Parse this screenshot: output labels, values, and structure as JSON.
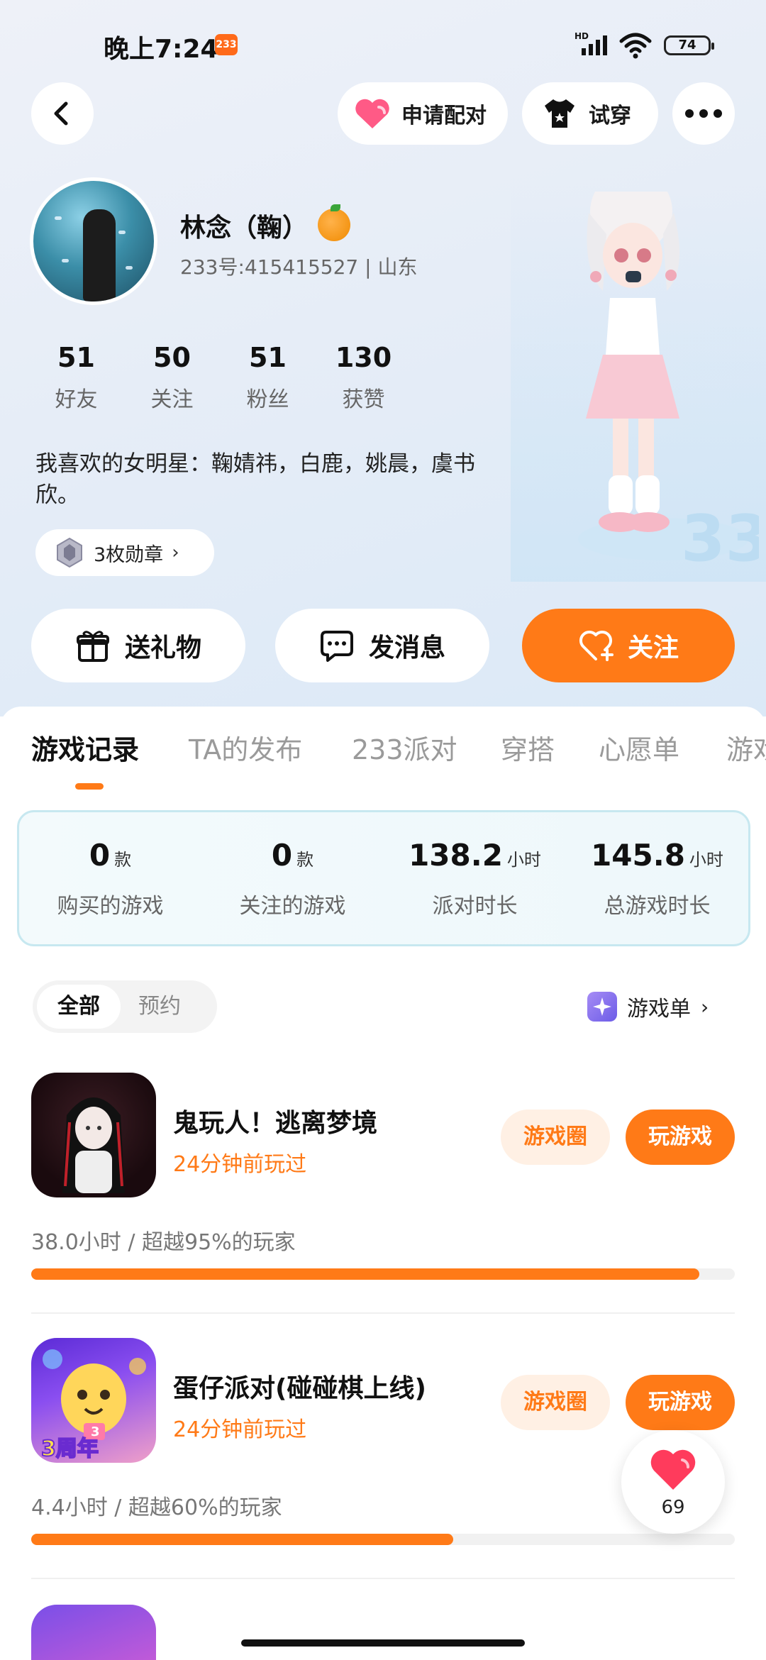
{
  "status": {
    "time": "晚上7:24",
    "badge": "233",
    "network": "HD",
    "battery": "74"
  },
  "header": {
    "pair_label": "申请配对",
    "try_label": "试穿"
  },
  "profile": {
    "name": "林念（鞠）",
    "id_line": "233号:415415527 | 山东",
    "stats": [
      {
        "value": "51",
        "label": "好友"
      },
      {
        "value": "50",
        "label": "关注"
      },
      {
        "value": "51",
        "label": "粉丝"
      },
      {
        "value": "130",
        "label": "获赞"
      }
    ],
    "bio": "我喜欢的女明星：鞠婧祎，白鹿，姚晨，虞书欣。",
    "badges": "3枚勋章"
  },
  "actions": {
    "gift": "送礼物",
    "message": "发消息",
    "follow": "关注"
  },
  "tabs": [
    "游戏记录",
    "TA的发布",
    "233派对",
    "穿搭",
    "心愿单",
    "游戏"
  ],
  "summary": [
    {
      "value": "0",
      "unit": "款",
      "label": "购买的游戏"
    },
    {
      "value": "0",
      "unit": "款",
      "label": "关注的游戏"
    },
    {
      "value": "138.2",
      "unit": "小时",
      "label": "派对时长"
    },
    {
      "value": "145.8",
      "unit": "小时",
      "label": "总游戏时长"
    }
  ],
  "filter": {
    "all": "全部",
    "reserve": "预约",
    "game_list": "游戏单"
  },
  "games": [
    {
      "title": "鬼玩人！逃离梦境",
      "played": "24分钟前玩过",
      "stat": "38.0小时 / 超越95%的玩家",
      "progress": 0.95,
      "circle_label": "游戏圈",
      "play_label": "玩游戏"
    },
    {
      "title": "蛋仔派对(碰碰棋上线)",
      "played": "24分钟前玩过",
      "stat": "4.4小时 / 超越60%的玩家",
      "progress": 0.6,
      "circle_label": "游戏圈",
      "play_label": "玩游戏"
    }
  ],
  "icon_text": {
    "game2_badge": "3周年"
  },
  "like": {
    "count": "69"
  },
  "colors": {
    "accent": "#ff7a17",
    "accent_soft": "#fff0e4",
    "heart": "#ff3b5c"
  }
}
